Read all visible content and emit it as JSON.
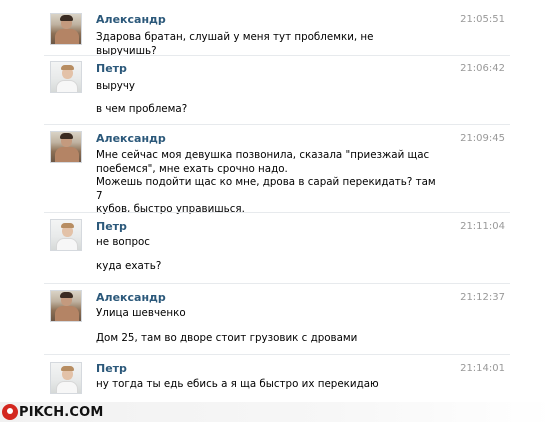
{
  "messages": [
    {
      "author": "Александр",
      "time": "21:05:51",
      "avatar_icon": "user-avatar",
      "lines": [
        "Здарова братан, слушай у меня тут проблемки, не выручишь?"
      ]
    },
    {
      "author": "Петр",
      "time": "21:06:42",
      "avatar_icon": "user-avatar",
      "lines": [
        "выручу",
        "в чем проблема?"
      ]
    },
    {
      "author": "Александр",
      "time": "21:09:45",
      "avatar_icon": "user-avatar",
      "lines": [
        "Мне сейчас моя девушка позвонила, сказала \"приезжай щас\nпоебемся\", мне ехать срочно надо.\nМожешь подойти щас ко мне, дрова в сарай перекидать? там 7\nкубов, быстро управишься."
      ]
    },
    {
      "author": "Петр",
      "time": "21:11:04",
      "avatar_icon": "user-avatar",
      "lines": [
        "не вопрос",
        "куда ехать?"
      ]
    },
    {
      "author": "Александр",
      "time": "21:12:37",
      "avatar_icon": "user-avatar",
      "lines": [
        "Улица шевченко",
        "Дом 25, там во дворе стоит грузовик с дровами"
      ]
    },
    {
      "author": "Петр",
      "time": "21:14:01",
      "avatar_icon": "user-avatar",
      "lines": [
        "ну тогда ты едь ебись а я ща быстро их перекидаю"
      ]
    }
  ],
  "watermark": {
    "text": "PIKCH.COM",
    "icon": "pikch-logo-icon",
    "color": "#d3271f"
  },
  "colors": {
    "author": "#2b587a",
    "time": "#999999",
    "text": "#000000"
  }
}
